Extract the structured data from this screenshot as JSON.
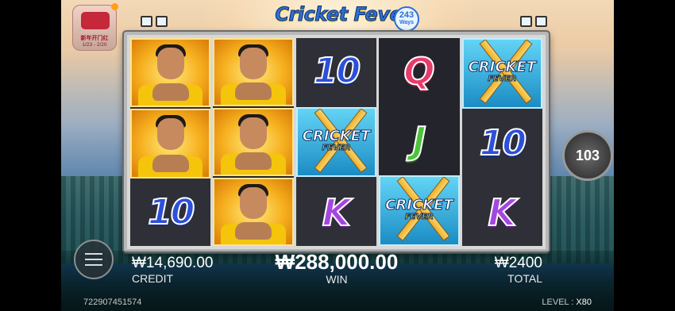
{
  "promo": {
    "title": "新年开门红",
    "date": "1/23 - 2/20"
  },
  "logo": {
    "title": "Cricket Fever",
    "ways_number": "243",
    "ways_label": "Ways"
  },
  "reels": [
    [
      "player",
      "player",
      "10"
    ],
    [
      "player",
      "player",
      "player"
    ],
    [
      "10",
      "cricket-fever-wild",
      "K"
    ],
    [
      "Q",
      "J",
      "cricket-fever-wild"
    ],
    [
      "cricket-fever-wild",
      "10",
      "K"
    ]
  ],
  "wild_symbol": {
    "line1": "CRICKET",
    "line2": "FEVER"
  },
  "spin_counter": "103",
  "credit": {
    "value": "₩14,690.00",
    "label": "CREDIT"
  },
  "win": {
    "value": "₩288,000.00",
    "label": "WIN"
  },
  "total": {
    "value": "₩2400",
    "label": "TOTAL"
  },
  "footer": {
    "id": "722907451574",
    "level_label": "LEVEL :",
    "level_value": "X80"
  },
  "colors": {
    "ten": "#2c50d8",
    "queen": "#e83b6a",
    "jack": "#4cc43a",
    "king": "#a546e0",
    "player_bg": "#f6b01f",
    "wild_bg": "#1b8cc4"
  }
}
